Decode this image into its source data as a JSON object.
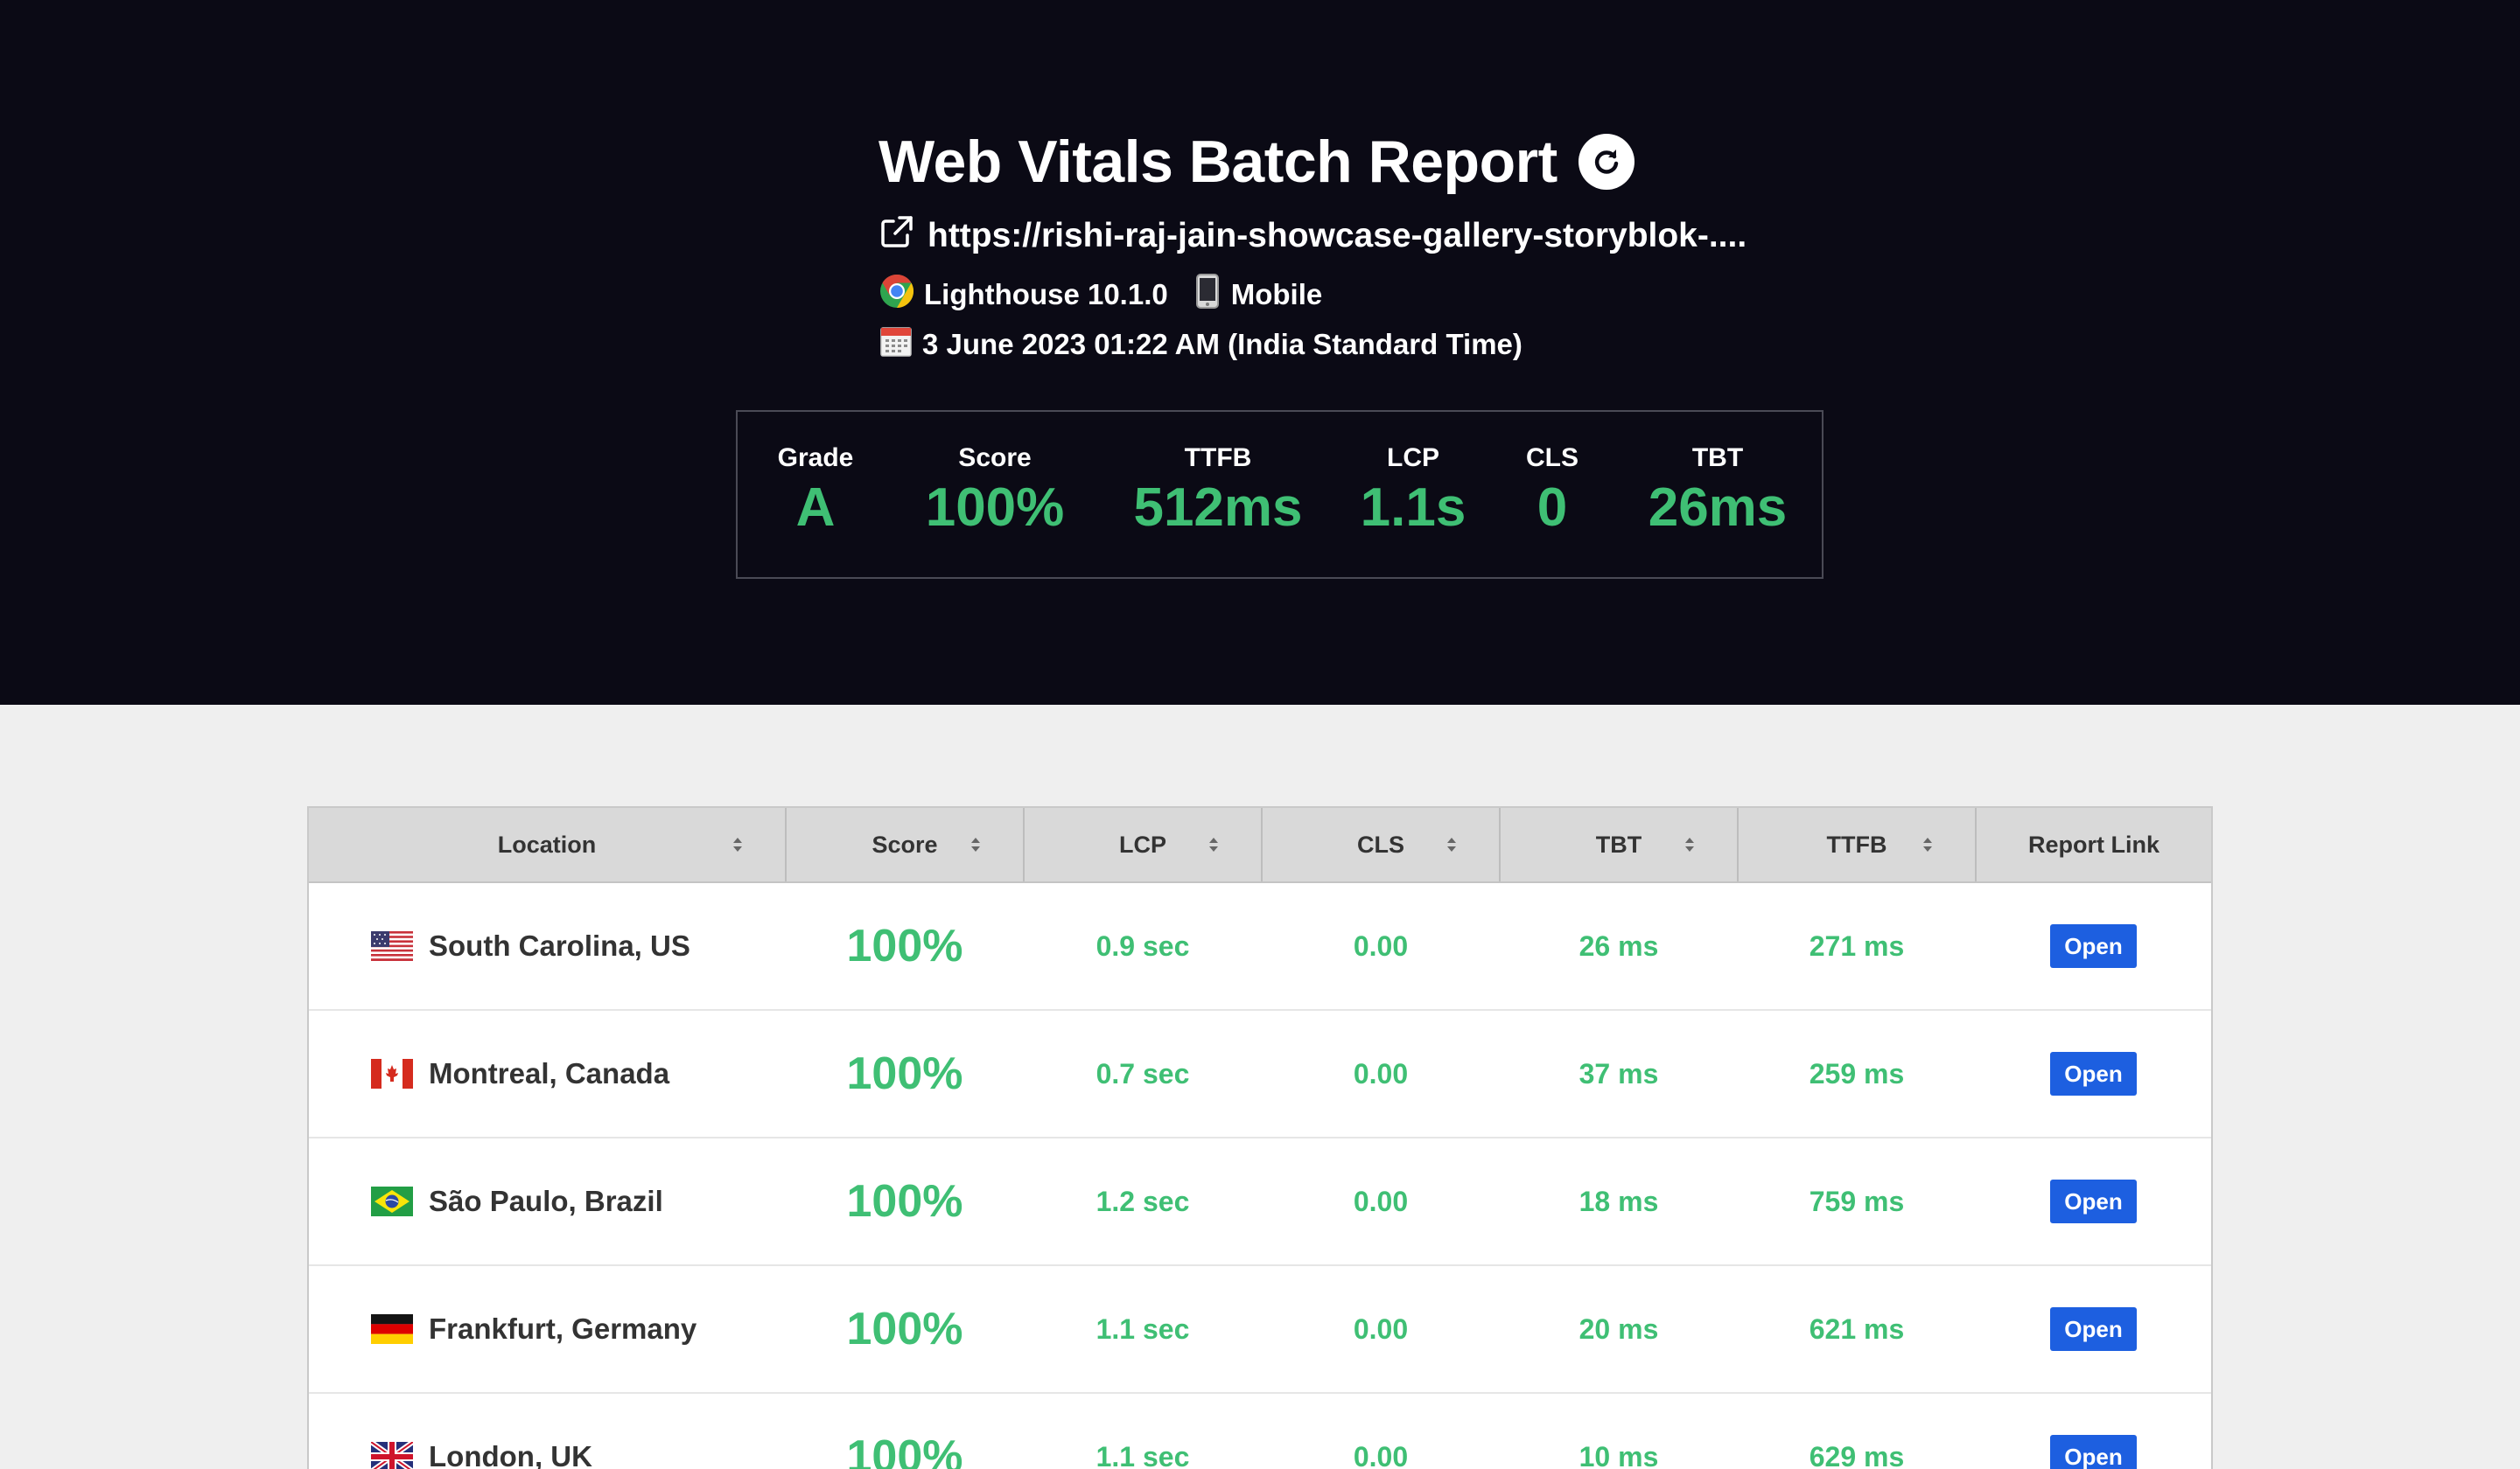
{
  "header": {
    "title": "Web Vitals Batch Report",
    "url": "https://rishi-raj-jain-showcase-gallery-storyblok-....",
    "tool": "Lighthouse 10.1.0",
    "device": "Mobile",
    "date": "3 June 2023 01:22 AM (India Standard Time)"
  },
  "summary": {
    "grade_label": "Grade",
    "grade_value": "A",
    "score_label": "Score",
    "score_value": "100%",
    "ttfb_label": "TTFB",
    "ttfb_value": "512ms",
    "lcp_label": "LCP",
    "lcp_value": "1.1s",
    "cls_label": "CLS",
    "cls_value": "0",
    "tbt_label": "TBT",
    "tbt_value": "26ms"
  },
  "table": {
    "headers": [
      "Location",
      "Score",
      "LCP",
      "CLS",
      "TBT",
      "TTFB",
      "Report Link"
    ],
    "button_label": "Open",
    "rows": [
      {
        "flag": "us-flag",
        "location": "South Carolina, US",
        "score": "100%",
        "lcp": "0.9 sec",
        "cls": "0.00",
        "tbt": "26 ms",
        "ttfb": "271 ms"
      },
      {
        "flag": "ca-flag",
        "location": "Montreal, Canada",
        "score": "100%",
        "lcp": "0.7 sec",
        "cls": "0.00",
        "tbt": "37 ms",
        "ttfb": "259 ms"
      },
      {
        "flag": "br-flag",
        "location": "São Paulo, Brazil",
        "score": "100%",
        "lcp": "1.2 sec",
        "cls": "0.00",
        "tbt": "18 ms",
        "ttfb": "759 ms"
      },
      {
        "flag": "de-flag",
        "location": "Frankfurt, Germany",
        "score": "100%",
        "lcp": "1.1 sec",
        "cls": "0.00",
        "tbt": "20 ms",
        "ttfb": "621 ms"
      },
      {
        "flag": "uk-flag",
        "location": "London, UK",
        "score": "100%",
        "lcp": "1.1 sec",
        "cls": "0.00",
        "tbt": "10 ms",
        "ttfb": "629 ms"
      }
    ]
  },
  "colors": {
    "good": "#3fbf74",
    "hero_bg": "#0b0a15",
    "button": "#1d5fe0"
  }
}
